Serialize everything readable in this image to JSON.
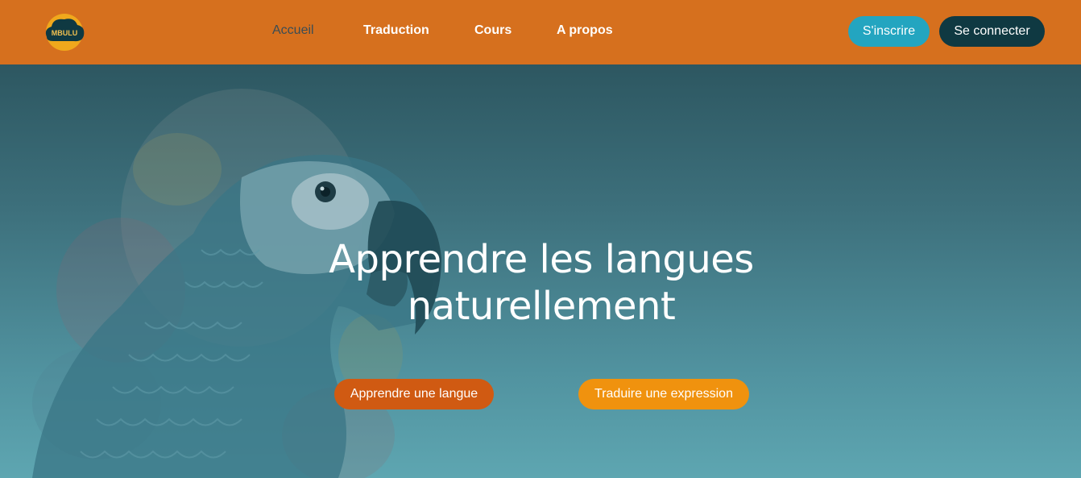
{
  "brand": {
    "logo_text": "MBULU"
  },
  "nav": {
    "items": [
      {
        "label": "Accueil",
        "active": true
      },
      {
        "label": "Traduction",
        "active": false
      },
      {
        "label": "Cours",
        "active": false
      },
      {
        "label": "A propos",
        "active": false
      }
    ]
  },
  "auth": {
    "signup_label": "S'inscrire",
    "login_label": "Se connecter"
  },
  "hero": {
    "title_line1": "Apprendre les langues",
    "title_line2": "naturellement",
    "learn_button": "Apprendre une langue",
    "translate_button": "Traduire une expression",
    "image": "parrot-illustration"
  },
  "colors": {
    "navbar": "#d6701e",
    "signup": "#23a5c0",
    "login": "#0f3942",
    "cta_learn": "#d05a12",
    "cta_translate": "#f0920e"
  }
}
